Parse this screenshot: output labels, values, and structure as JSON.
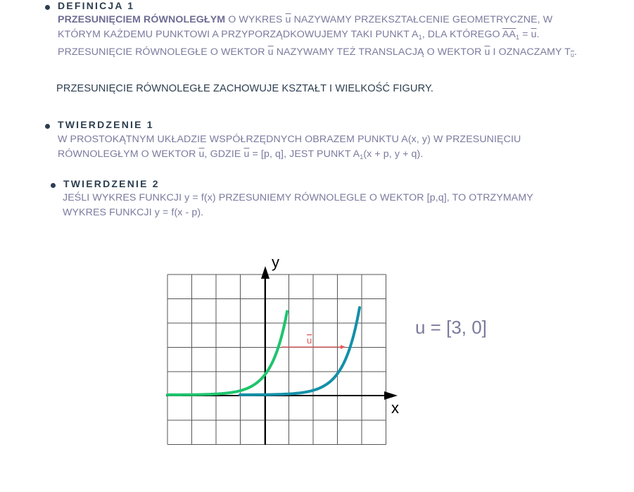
{
  "def1": {
    "heading": "DEFINICJA 1",
    "bold": "PRZESUNIĘCIEM RÓWNOLEGŁYM",
    "l1a": " O WYKRES ",
    "u": "u",
    "l1b": " NAZYWAMY PRZEKSZTAŁCENIE GEOMETRYCZNE, W",
    "l2a": "KTÓRYM KAŻDEMU PUNKTOWI A PRZYPORZĄDKOWUJEMY TAKI PUNKT A",
    "sub1": "1",
    "l2b": ", DLA KTÓREGO ",
    "aa1": "AA",
    "l2c": " = ",
    "l2d": ".",
    "l3a": "PRZESUNIĘCIE RÓWNOLEGŁE O WEKTOR ",
    "l3b": " NAZYWAMY TEŻ TRANSLACJĄ O WEKTOR ",
    "l3c": " I OZNACZAMY T",
    "l3d": "."
  },
  "note": "PRZESUNIĘCIE RÓWNOLEGŁE ZACHOWUJE KSZTAŁT I WIELKOŚĆ FIGURY.",
  "thm1": {
    "heading": "TWIERDZENIE 1",
    "l1": "W PROSTOKĄTNYM UKŁADZIE WSPÓŁRZĘDNYCH OBRAZEM PUNKTU A(x, y) W PRZESUNIĘCIU",
    "l2a": "RÓWNOLEGŁYM O WEKTOR ",
    "u": "u",
    "l2b": ", GDZIE ",
    "l2c": " = [p, q], JEST PUNKT A",
    "sub1": "1",
    "l2d": "(x + p, y + q)."
  },
  "thm2": {
    "heading": "TWIERDZENIE 2",
    "l1": "JEŚLI WYKRES FUNKCJI y = f(x) PRZESUNIEMY RÓWNOLEGLE O WEKTOR [p,q], TO OTRZYMAMY",
    "l2": "WYKRES FUNKCJI y = f(x - p)."
  },
  "graph": {
    "y_label": "y",
    "x_label": "x",
    "vector_label": "u",
    "formula": "u = [3, 0]",
    "colors": {
      "grid": "#555555",
      "original_curve": "#1ec46e",
      "shifted_curve": "#1490a8",
      "vector": "#e05a5a",
      "axis": "#000000"
    }
  }
}
